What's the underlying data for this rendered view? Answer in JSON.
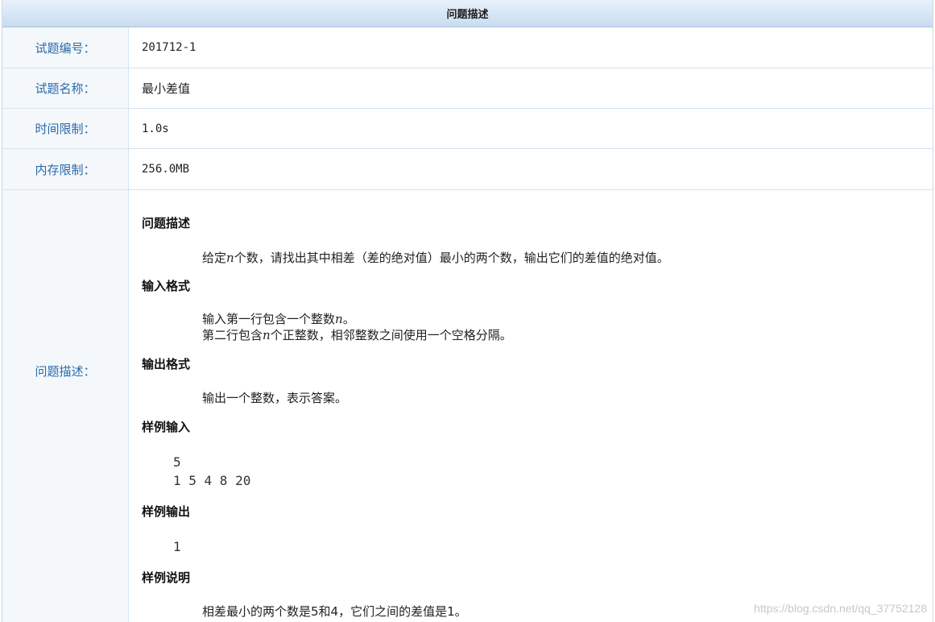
{
  "header": {
    "title": "问题描述"
  },
  "info_rows": [
    {
      "label": "试题编号：",
      "value": "201712-1"
    },
    {
      "label": "试题名称：",
      "value": "最小差值"
    },
    {
      "label": "时间限制：",
      "value": "1.0s"
    },
    {
      "label": "内存限制：",
      "value": "256.0MB"
    }
  ],
  "description": {
    "label": "问题描述：",
    "sections": {
      "problem": {
        "title": "问题描述",
        "text_before": "给定",
        "var": "n",
        "text_after": "个数，请找出其中相差（差的绝对值）最小的两个数，输出它们的差值的绝对值。"
      },
      "input_format": {
        "title": "输入格式",
        "line1_before": "输入第一行包含一个整数",
        "line1_var": "n",
        "line1_after": "。",
        "line2_before": "第二行包含",
        "line2_var": "n",
        "line2_after": "个正整数，相邻整数之间使用一个空格分隔。"
      },
      "output_format": {
        "title": "输出格式",
        "text": "输出一个整数，表示答案。"
      },
      "sample_input": {
        "title": "样例输入",
        "line1": "5",
        "line2": "1 5 4 8 20"
      },
      "sample_output": {
        "title": "样例输出",
        "line1": "1"
      },
      "sample_explanation": {
        "title": "样例说明",
        "text": "相差最小的两个数是5和4，它们之间的差值是1。"
      }
    }
  },
  "watermark": "https://blog.csdn.net/qq_37752128"
}
